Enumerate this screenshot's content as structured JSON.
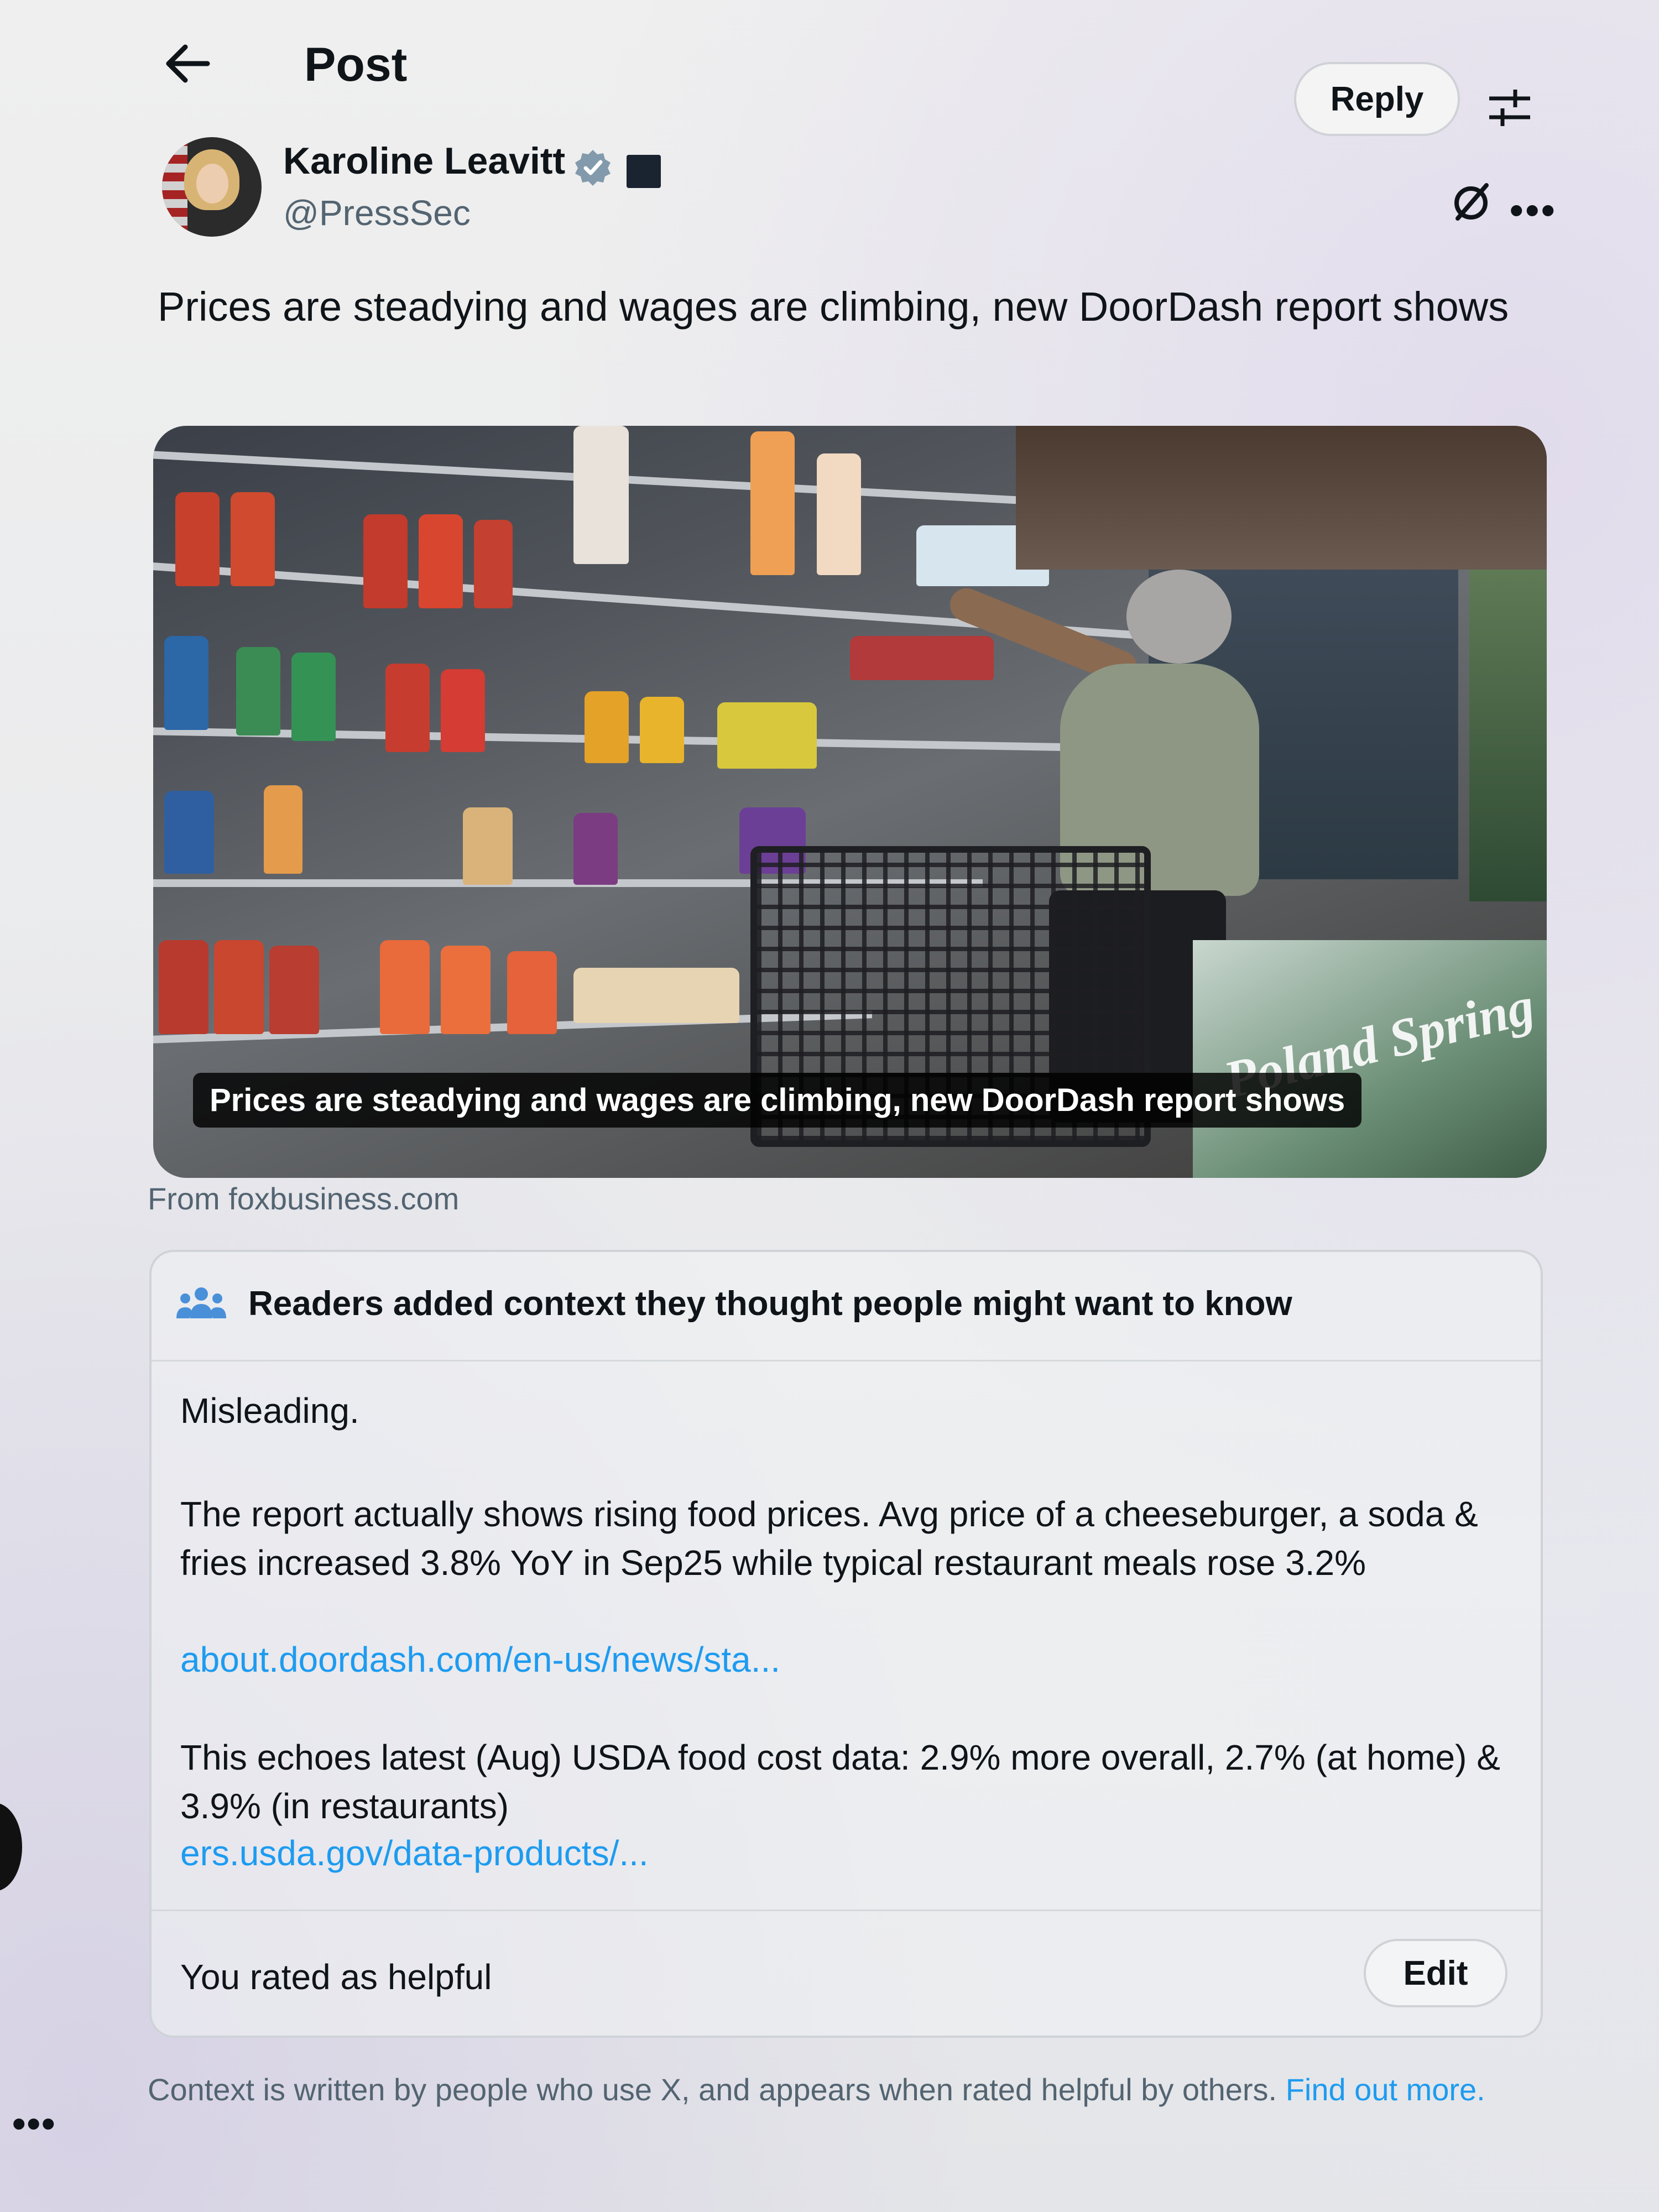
{
  "header": {
    "title": "Post",
    "reply_label": "Reply"
  },
  "author": {
    "name": "Karoline Leavitt",
    "handle": "@PressSec"
  },
  "post": {
    "text": "Prices are steadying and wages are climbing, new DoorDash report shows"
  },
  "link_card": {
    "caption": "Prices are steadying and wages are climbing, new DoorDash report shows",
    "source": "From foxbusiness.com",
    "image_text": "Poland Spring"
  },
  "community_note": {
    "header": "Readers added context they thought people might want to know",
    "verdict": "Misleading.",
    "paragraph1": "The report actually shows rising food prices. Avg price of a cheeseburger, a soda & fries increased 3.8% YoY in Sep25 while typical restaurant meals rose 3.2%",
    "link1": "about.doordash.com/en-us/news/sta...",
    "paragraph2": "This echoes latest (Aug) USDA food cost data: 2.9% more overall, 2.7% (at home) & 3.9% (in restaurants)",
    "link2": "ers.usda.gov/data-products/...",
    "rated_text": "You rated as helpful",
    "edit_label": "Edit"
  },
  "footer": {
    "context_info": "Context is written by people who use X, and appears when rated helpful by others.",
    "find_out_more": "Find out more."
  },
  "colors": {
    "accent_link": "#1d9bf0",
    "secondary_text": "#536471",
    "primary_text": "#0f1419",
    "verified_badge": "#829aab"
  },
  "icons": {
    "back": "arrow-left-icon",
    "filter": "sliders-icon",
    "verified": "verified-badge-icon",
    "affiliation": "affiliation-badge-icon",
    "grok": "grok-icon",
    "more": "more-icon",
    "people": "people-icon"
  }
}
